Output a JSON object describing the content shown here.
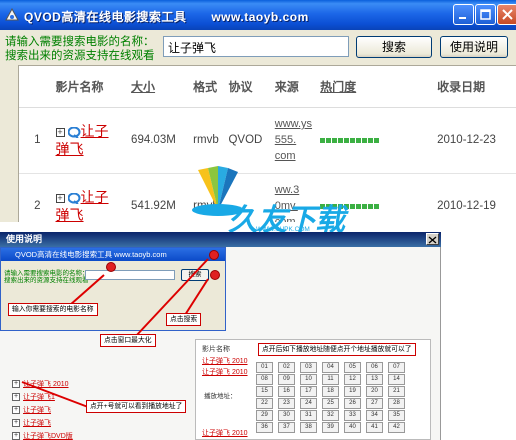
{
  "window": {
    "title": "QVOD高清在线电影搜索工具　　www.taoyb.com",
    "prompt_line1": "请输入需要搜索电影的名称：",
    "prompt_line2": "搜索出来的资源支持在线观看",
    "search_value": "让子弹飞",
    "search_button": "搜索",
    "help_button": "使用说明"
  },
  "results": {
    "headers": [
      "影片名称",
      "大小",
      "格式",
      "协议",
      "来源",
      "热门度",
      "收录日期"
    ],
    "rows": [
      {
        "index": "1",
        "name_line1": "让子",
        "name_line2": "弹飞",
        "size": "694.03M",
        "format": "rmvb",
        "protocol": "QVOD",
        "source_lines": [
          "www.ys",
          "555.",
          "com"
        ],
        "heat": 10,
        "date": "2010-12-23"
      },
      {
        "index": "2",
        "name_line1": "让子",
        "name_line2": "弹飞",
        "size": "541.92M",
        "format": "rmvb",
        "protocol": "",
        "source_lines": [
          "ww.3",
          "0mv.",
          "com"
        ],
        "heat": 10,
        "date": "2010-12-19"
      }
    ]
  },
  "watermark": {
    "text": "久友下载",
    "sub": "WWW.9UPK.COM"
  },
  "help": {
    "title": "使用说明",
    "mini_title": "QVOD高清在线电影搜索工具  www.taoyb.com",
    "mini_prompt1": "请输入需要搜索电影的名称：",
    "mini_prompt2": "搜索出来的资源支持在线观看",
    "mini_search": "搜索",
    "callouts": {
      "input_name": "输入你需要搜索的电影名称",
      "maximize": "点击窗口最大化",
      "click_search": "点击搜索",
      "expand_tip": "点开+号就可以看到播放地址了",
      "play_tip": "点开后如下播放地址随便点开个地址播放就可以了"
    },
    "tree": [
      {
        "label": "让子弹飞 2010",
        "sign": "+"
      },
      {
        "label": "让子弹飞1",
        "sign": "+"
      },
      {
        "label": "让子弹飞",
        "sign": "+"
      },
      {
        "label": "让子弹飞",
        "sign": "+"
      },
      {
        "label": "让子弹飞DVD版",
        "sign": "+"
      }
    ],
    "panel": {
      "header": "影片名称",
      "rows": [
        "让子弹飞 2010",
        "让子弹飞 2010"
      ],
      "play_label": "播放地址：",
      "episodes": [
        "01",
        "02",
        "03",
        "04",
        "05",
        "06",
        "07",
        "08",
        "09",
        "10",
        "11",
        "12",
        "13",
        "14",
        "15",
        "16",
        "17",
        "18",
        "19",
        "20",
        "21",
        "22",
        "23",
        "24",
        "25",
        "26",
        "27",
        "28",
        "29",
        "30",
        "31",
        "32",
        "33",
        "34",
        "35",
        "36",
        "37",
        "38",
        "39",
        "40",
        "41",
        "42"
      ],
      "footer": "让子弹飞 2010"
    }
  }
}
